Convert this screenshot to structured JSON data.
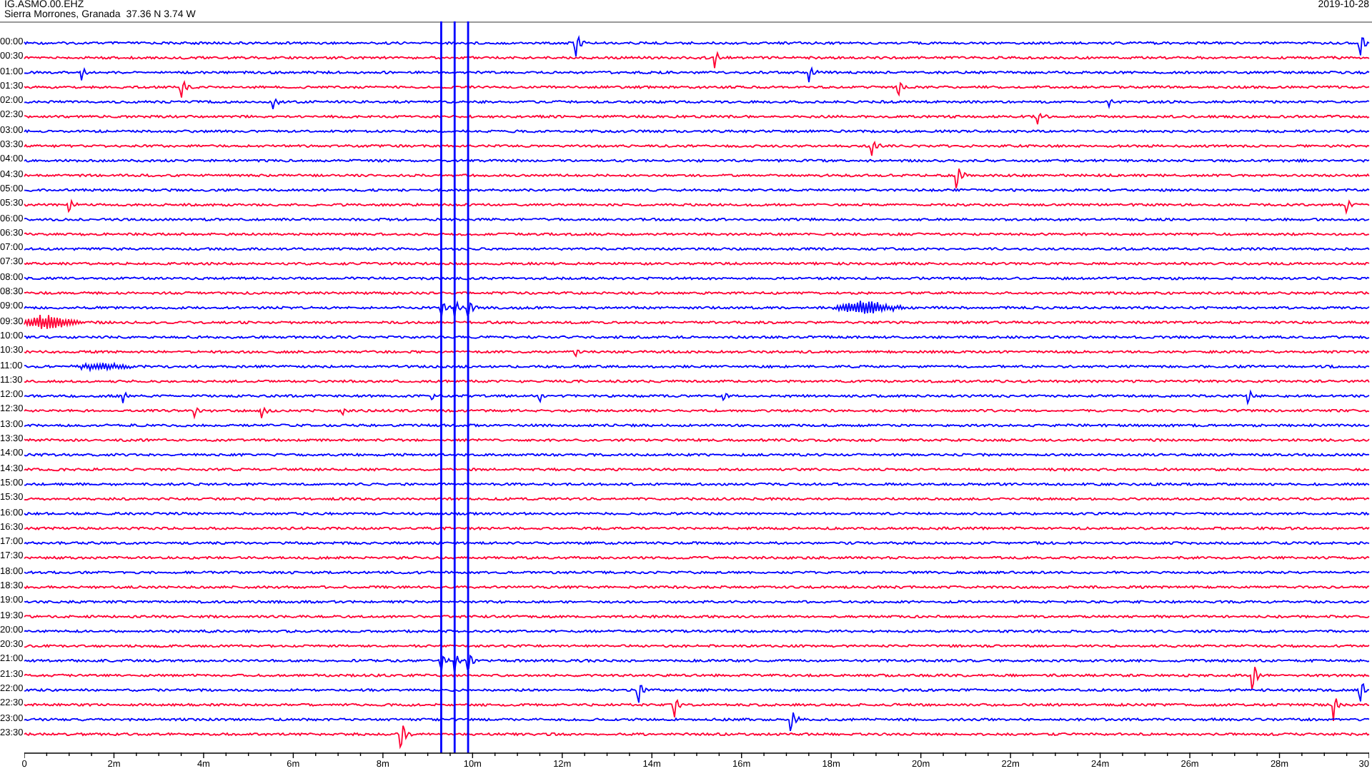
{
  "header": {
    "station": "IG.ASMO.00.EHZ",
    "location": "Sierra Morrones, Granada  37.36 N 3.74 W",
    "date": "2019-10-28"
  },
  "traces": [
    {
      "label": "00:00",
      "color": "#0000ff"
    },
    {
      "label": "00:30",
      "color": "#ff0033"
    },
    {
      "label": "01:00",
      "color": "#0000ff"
    },
    {
      "label": "01:30",
      "color": "#ff0033"
    },
    {
      "label": "02:00",
      "color": "#0000ff"
    },
    {
      "label": "02:30",
      "color": "#ff0033"
    },
    {
      "label": "03:00",
      "color": "#0000ff"
    },
    {
      "label": "03:30",
      "color": "#ff0033"
    },
    {
      "label": "04:00",
      "color": "#0000ff"
    },
    {
      "label": "04:30",
      "color": "#ff0033"
    },
    {
      "label": "05:00",
      "color": "#0000ff"
    },
    {
      "label": "05:30",
      "color": "#ff0033"
    },
    {
      "label": "06:00",
      "color": "#0000ff"
    },
    {
      "label": "06:30",
      "color": "#ff0033"
    },
    {
      "label": "07:00",
      "color": "#0000ff"
    },
    {
      "label": "07:30",
      "color": "#ff0033"
    },
    {
      "label": "08:00",
      "color": "#0000ff"
    },
    {
      "label": "08:30",
      "color": "#ff0033"
    },
    {
      "label": "09:00",
      "color": "#0000ff"
    },
    {
      "label": "09:30",
      "color": "#ff0033"
    },
    {
      "label": "10:00",
      "color": "#0000ff"
    },
    {
      "label": "10:30",
      "color": "#ff0033"
    },
    {
      "label": "11:00",
      "color": "#0000ff"
    },
    {
      "label": "11:30",
      "color": "#ff0033"
    },
    {
      "label": "12:00",
      "color": "#0000ff"
    },
    {
      "label": "12:30",
      "color": "#ff0033"
    },
    {
      "label": "13:00",
      "color": "#0000ff"
    },
    {
      "label": "13:30",
      "color": "#ff0033"
    },
    {
      "label": "14:00",
      "color": "#0000ff"
    },
    {
      "label": "14:30",
      "color": "#ff0033"
    },
    {
      "label": "15:00",
      "color": "#0000ff"
    },
    {
      "label": "15:30",
      "color": "#ff0033"
    },
    {
      "label": "16:00",
      "color": "#0000ff"
    },
    {
      "label": "16:30",
      "color": "#ff0033"
    },
    {
      "label": "17:00",
      "color": "#0000ff"
    },
    {
      "label": "17:30",
      "color": "#ff0033"
    },
    {
      "label": "18:00",
      "color": "#0000ff"
    },
    {
      "label": "18:30",
      "color": "#ff0033"
    },
    {
      "label": "19:00",
      "color": "#0000ff"
    },
    {
      "label": "19:30",
      "color": "#ff0033"
    },
    {
      "label": "20:00",
      "color": "#0000ff"
    },
    {
      "label": "20:30",
      "color": "#ff0033"
    },
    {
      "label": "21:00",
      "color": "#0000ff"
    },
    {
      "label": "21:30",
      "color": "#ff0033"
    },
    {
      "label": "22:00",
      "color": "#0000ff"
    },
    {
      "label": "22:30",
      "color": "#ff0033"
    },
    {
      "label": "23:00",
      "color": "#0000ff"
    },
    {
      "label": "23:30",
      "color": "#ff0033"
    }
  ],
  "x_axis_labels": [
    "0",
    "2m",
    "4m",
    "6m",
    "8m",
    "10m",
    "12m",
    "14m",
    "16m",
    "18m",
    "20m",
    "22m",
    "24m",
    "26m",
    "28m",
    "30"
  ]
}
